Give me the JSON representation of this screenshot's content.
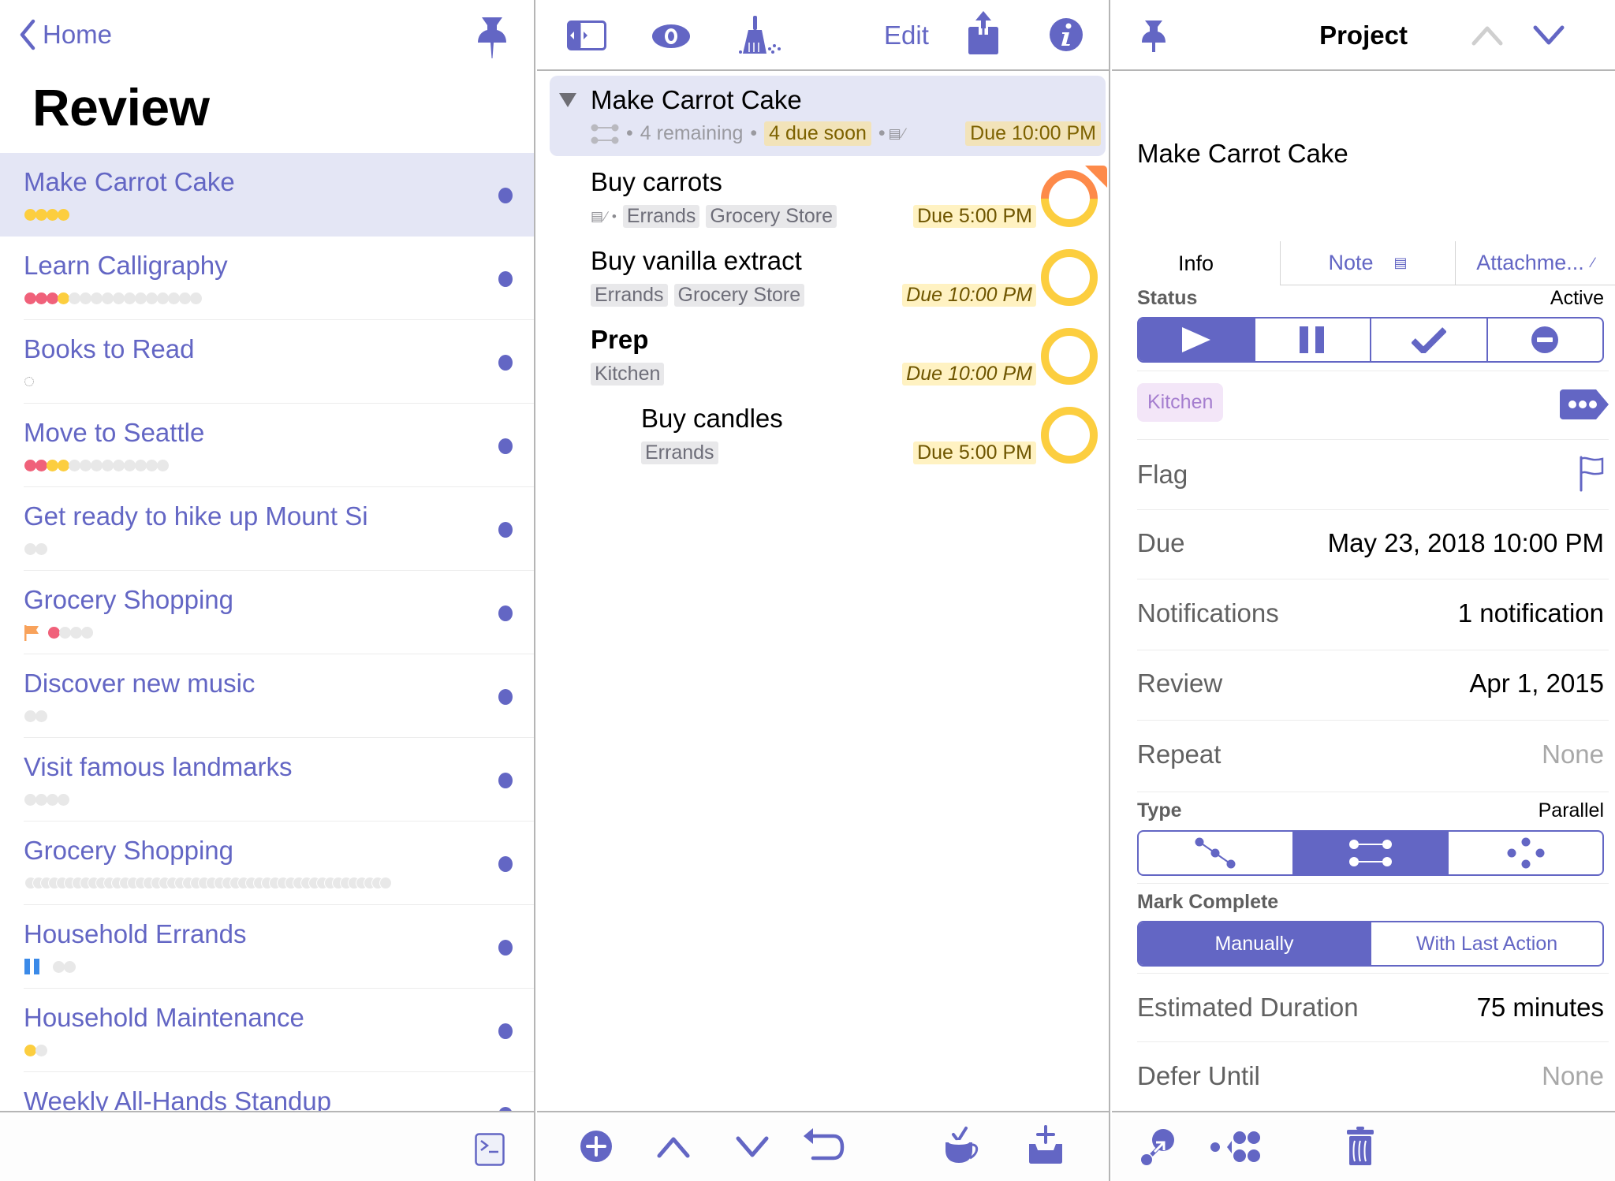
{
  "colors": {
    "accent": "#6366c4",
    "selection": "#e4e6f5",
    "due_soon_bg": "#fff2c2",
    "overdue": "#fd8a4a",
    "due_soon": "#fcce3f",
    "flag_orange": "#f8a25b",
    "paused_blue": "#3b8ae8",
    "dot_red": "#f0617a",
    "dot_gray": "#e8e8e8",
    "tag_kitchen_bg": "#f3e6f8"
  },
  "left": {
    "back_label": "Home",
    "title": "Review",
    "pin_icon": "pushpin-icon",
    "projects": [
      {
        "name": "Make Carrot Cake",
        "selected": true,
        "dots": [
          "y",
          "y",
          "y",
          "y"
        ]
      },
      {
        "name": "Learn Calligraphy",
        "dots": [
          "r",
          "r",
          "r",
          "y",
          "g",
          "g",
          "g",
          "g",
          "g",
          "g",
          "g",
          "g",
          "g",
          "g",
          "g",
          "g"
        ]
      },
      {
        "name": "Books to Read",
        "dots": [
          "ring"
        ]
      },
      {
        "name": "Move to Seattle",
        "dots": [
          "r",
          "r",
          "y",
          "y",
          "g",
          "g",
          "g",
          "g",
          "g",
          "g",
          "g",
          "g",
          "g"
        ]
      },
      {
        "name": "Get ready to hike up Mount Si",
        "dots": [
          "g",
          "g"
        ]
      },
      {
        "name": "Grocery Shopping",
        "flagged": true,
        "dots": [
          "r",
          "g",
          "g",
          "g"
        ]
      },
      {
        "name": "Discover new music",
        "dots": [
          "g",
          "g"
        ]
      },
      {
        "name": "Visit famous landmarks",
        "dots": [
          "g",
          "g",
          "g",
          "g"
        ]
      },
      {
        "name": "Grocery Shopping",
        "dense_dots": 46
      },
      {
        "name": "Household Errands",
        "paused": true,
        "dots": [
          "g",
          "g"
        ]
      },
      {
        "name": "Household Maintenance",
        "dots": [
          "y",
          "g"
        ]
      },
      {
        "name": "Weekly All-Hands Standup",
        "dots": []
      }
    ],
    "footer_icon": "console-icon"
  },
  "middle": {
    "toolbar": {
      "sidebar_toggle_icon": "sidebar-toggle-icon",
      "view_icon": "eye-icon",
      "clean_up_icon": "broom-icon",
      "edit_label": "Edit",
      "share_icon": "share-icon",
      "info_icon": "info-icon"
    },
    "project": {
      "title": "Make Carrot Cake",
      "remaining": "4 remaining",
      "due_soon": "4 due soon",
      "due": "Due 10:00 PM"
    },
    "tasks": [
      {
        "name": "Buy carrots",
        "tags": [
          "Errands",
          "Grocery Store"
        ],
        "has_note": true,
        "has_attachment": true,
        "due": "Due 5:00 PM",
        "status": "overdue"
      },
      {
        "name": "Buy vanilla extract",
        "tags": [
          "Errands",
          "Grocery Store"
        ],
        "due": "Due 10:00 PM",
        "status": "due-soon",
        "inherited_due": true
      },
      {
        "name": "Prep",
        "tags": [
          "Kitchen"
        ],
        "due": "Due 10:00 PM",
        "status": "due-soon",
        "inherited_due": true,
        "group": true
      },
      {
        "name": "Buy candles",
        "tags": [
          "Errands"
        ],
        "due": "Due 5:00 PM",
        "status": "due-soon",
        "indent": 1
      }
    ],
    "footer": {
      "add_icon": "add-circle-icon",
      "move_up_icon": "chevron-up-icon",
      "move_down_icon": "chevron-down-icon",
      "outdent_icon": "undo-arrow-icon",
      "quick_entry_icon": "coffee-cup-icon",
      "inbox_add_icon": "inbox-add-icon"
    }
  },
  "inspector": {
    "header_title": "Project",
    "item_title": "Make Carrot Cake",
    "tabs": {
      "info": "Info",
      "note": "Note",
      "attachments": "Attachme..."
    },
    "status": {
      "label": "Status",
      "value": "Active",
      "options": [
        "Active",
        "On Hold",
        "Completed",
        "Dropped"
      ],
      "selected": 0
    },
    "tags": [
      "Kitchen"
    ],
    "flag_label": "Flag",
    "due": {
      "label": "Due",
      "value": "May 23, 2018  10:00 PM"
    },
    "notifications": {
      "label": "Notifications",
      "value": "1 notification"
    },
    "review": {
      "label": "Review",
      "value": "Apr 1, 2015"
    },
    "repeat": {
      "label": "Repeat",
      "value": "None"
    },
    "type": {
      "label": "Type",
      "value": "Parallel",
      "options": [
        "Sequential",
        "Parallel",
        "Single Actions"
      ],
      "selected": 1
    },
    "mark_complete": {
      "label": "Mark Complete",
      "options": [
        "Manually",
        "With Last Action"
      ],
      "selected": 0
    },
    "estimated_duration": {
      "label": "Estimated Duration",
      "value": "75 minutes"
    },
    "defer_until": {
      "label": "Defer Until",
      "value": "None"
    },
    "footer": {
      "convert_icon": "convert-to-project-icon",
      "group_icon": "group-actions-icon",
      "delete_icon": "trash-icon"
    }
  }
}
